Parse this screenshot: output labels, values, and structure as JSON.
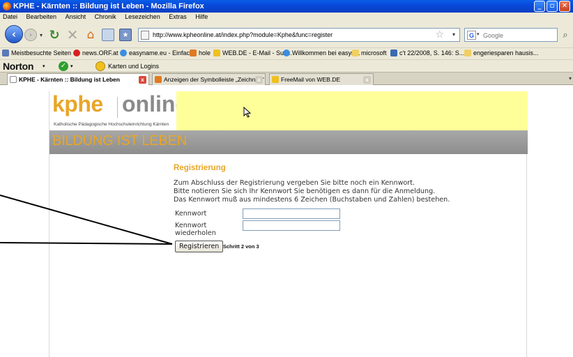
{
  "window": {
    "title": "KPHE - Kärnten :: Bildung ist Leben - Mozilla Firefox",
    "minimize": "_",
    "maximize": "▫",
    "close": "✕"
  },
  "menu": {
    "items": [
      "Datei",
      "Bearbeiten",
      "Ansicht",
      "Chronik",
      "Lesezeichen",
      "Extras",
      "Hilfe"
    ]
  },
  "navigation": {
    "url": "http://www.kpheonline.at/index.php?module=Kphe&func=register",
    "search_placeholder": "Google",
    "search_engine_letter": "G"
  },
  "bookmarks": {
    "items": [
      "Meistbesuchte Seiten",
      "news.ORF.at",
      "easyname.eu - Einfac...",
      "hole",
      "WEB.DE - E-Mail - Suc...",
      "Willkommen bei easyn...",
      "microsoft",
      "c't 22/2008, S. 146: S...",
      "engeriesparen hausis..."
    ]
  },
  "norton": {
    "label": "Norton",
    "cards_label": "Karten und Logins"
  },
  "tabs": [
    {
      "label": "KPHE - Kärnten :: Bildung ist Leben",
      "active": true
    },
    {
      "label": "Anzeigen der Symbolleiste „Zeichnen\" - ...",
      "active": false
    },
    {
      "label": "FreeMail von WEB.DE",
      "active": false
    }
  ],
  "site": {
    "logo_kphe": "kphe",
    "logo_online": "online",
    "logo_subtitle": "Katholische Pädagogische Hochschuleinrichtung Kärnten",
    "motto": "BILDUNG IST LEBEN"
  },
  "form": {
    "title": "Registrierung",
    "text_lines": [
      "Zum Abschluss der Registrierung vergeben Sie bitte noch ein Kennwort.",
      "Bitte notieren Sie sich Ihr Kennwort Sie benötigen es dann für die Anmeldung.",
      "Das Kennwort muß aus mindestens 6 Zeichen (Buchstaben und Zahlen) bestehen."
    ],
    "password_label": "Kennwort",
    "password_repeat_label_line1": "Kennwort",
    "password_repeat_label_line2": "wiederholen",
    "submit_label": "Registrieren",
    "step_label": "Schritt 2 von 3"
  },
  "colors": {
    "brand_orange": "#e8a628",
    "banner_yellow": "#ffff99",
    "motto_bar_grey": "#9a9a9a",
    "logo_grey": "#8a8a8a"
  }
}
